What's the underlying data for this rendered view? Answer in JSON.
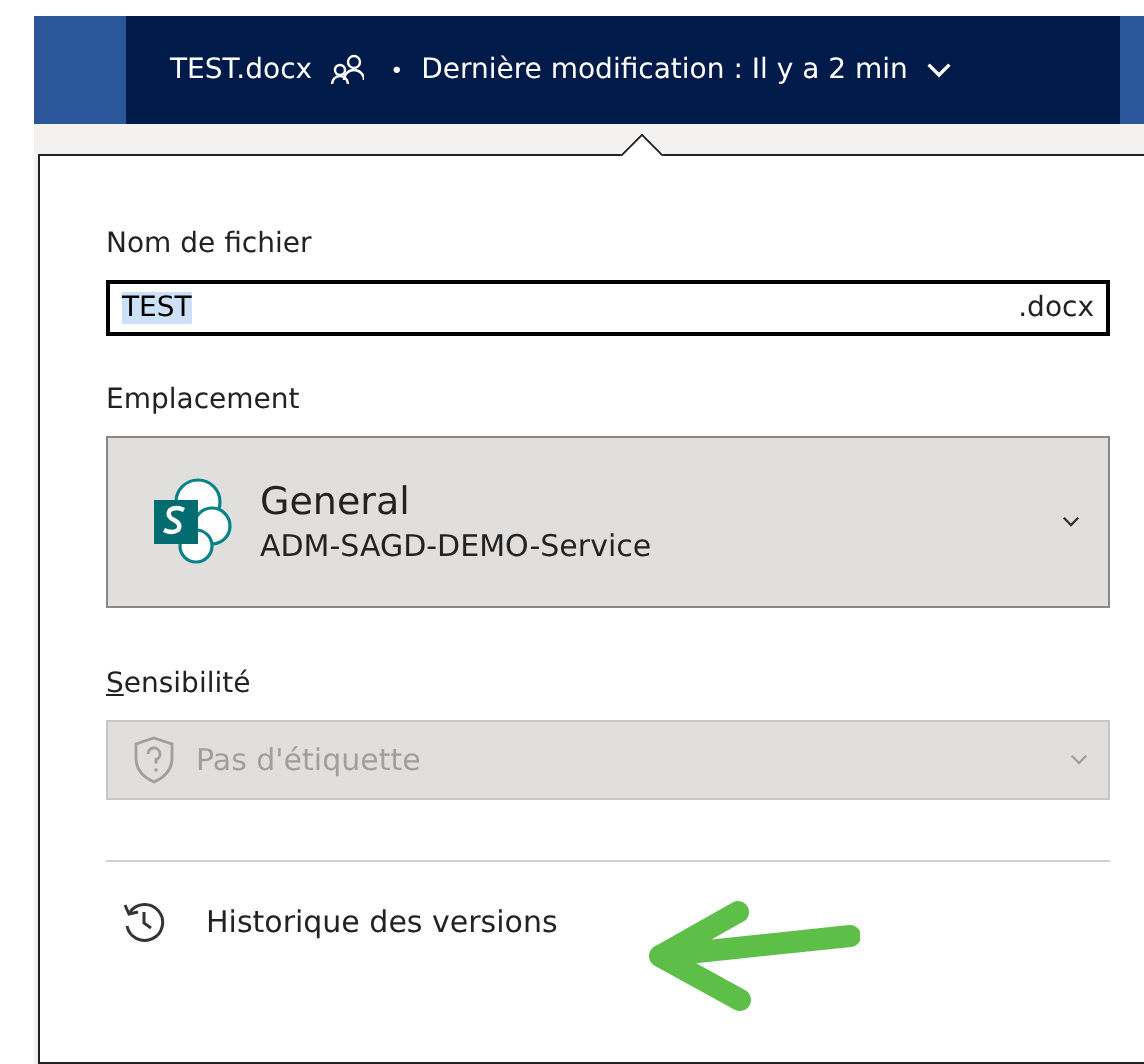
{
  "title_bar": {
    "file_name": "TEST.docx",
    "separator": "•",
    "last_modified": "Dernière modification : Il y a 2 min"
  },
  "file_name": {
    "label": "Nom de fichier",
    "value": "TEST",
    "value_selected": true,
    "extension": ".docx"
  },
  "location": {
    "label": "Emplacement",
    "site": "General",
    "group": "ADM-SAGD-DEMO-Service"
  },
  "sensitivity": {
    "label": "Sensibilité",
    "value": "Pas d'étiquette",
    "disabled": true
  },
  "actions": [
    {
      "kind": "history",
      "label": "Historique des versions"
    }
  ]
}
